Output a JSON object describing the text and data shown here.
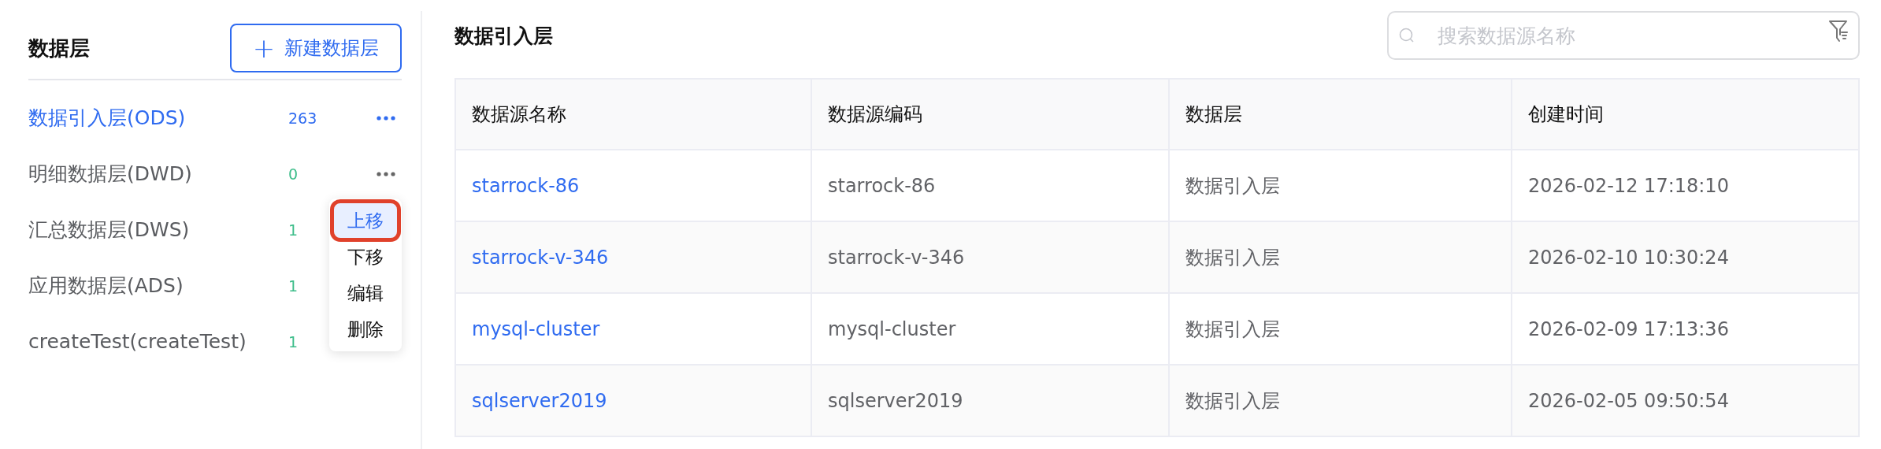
{
  "sidebar": {
    "title": "数据层",
    "new_button": {
      "icon": "+",
      "label": "新建数据层"
    },
    "items": [
      {
        "label": "数据引入层(ODS)",
        "count": "263",
        "selected": true,
        "actions_visible": true
      },
      {
        "label": "明细数据层(DWD)",
        "count": "0",
        "selected": false,
        "actions_visible": true
      },
      {
        "label": "汇总数据层(DWS)",
        "count": "1",
        "selected": false,
        "actions_visible": false
      },
      {
        "label": "应用数据层(ADS)",
        "count": "1",
        "selected": false,
        "actions_visible": false
      },
      {
        "label": "createTest(createTest)",
        "count": "1",
        "selected": false,
        "actions_visible": false
      }
    ],
    "context_menu": {
      "items": [
        {
          "label": "上移",
          "hovered": true,
          "annotated": true
        },
        {
          "label": "下移",
          "hovered": false,
          "annotated": false
        },
        {
          "label": "编辑",
          "hovered": false,
          "annotated": false
        },
        {
          "label": "删除",
          "hovered": false,
          "annotated": false
        }
      ]
    }
  },
  "main": {
    "title": "数据引入层",
    "search": {
      "placeholder": "搜索数据源名称"
    },
    "table": {
      "columns": [
        "数据源名称",
        "数据源编码",
        "数据层",
        "创建时间"
      ],
      "rows": [
        [
          "starrock-86",
          "starrock-86",
          "数据引入层",
          "2026-02-12 17:18:10"
        ],
        [
          "starrock-v-346",
          "starrock-v-346",
          "数据引入层",
          "2026-02-10 10:30:24"
        ],
        [
          "mysql-cluster",
          "mysql-cluster",
          "数据引入层",
          "2026-02-09 17:13:36"
        ],
        [
          "sqlserver2019",
          "sqlserver2019",
          "数据引入层",
          "2026-02-05 09:50:54"
        ]
      ]
    }
  }
}
